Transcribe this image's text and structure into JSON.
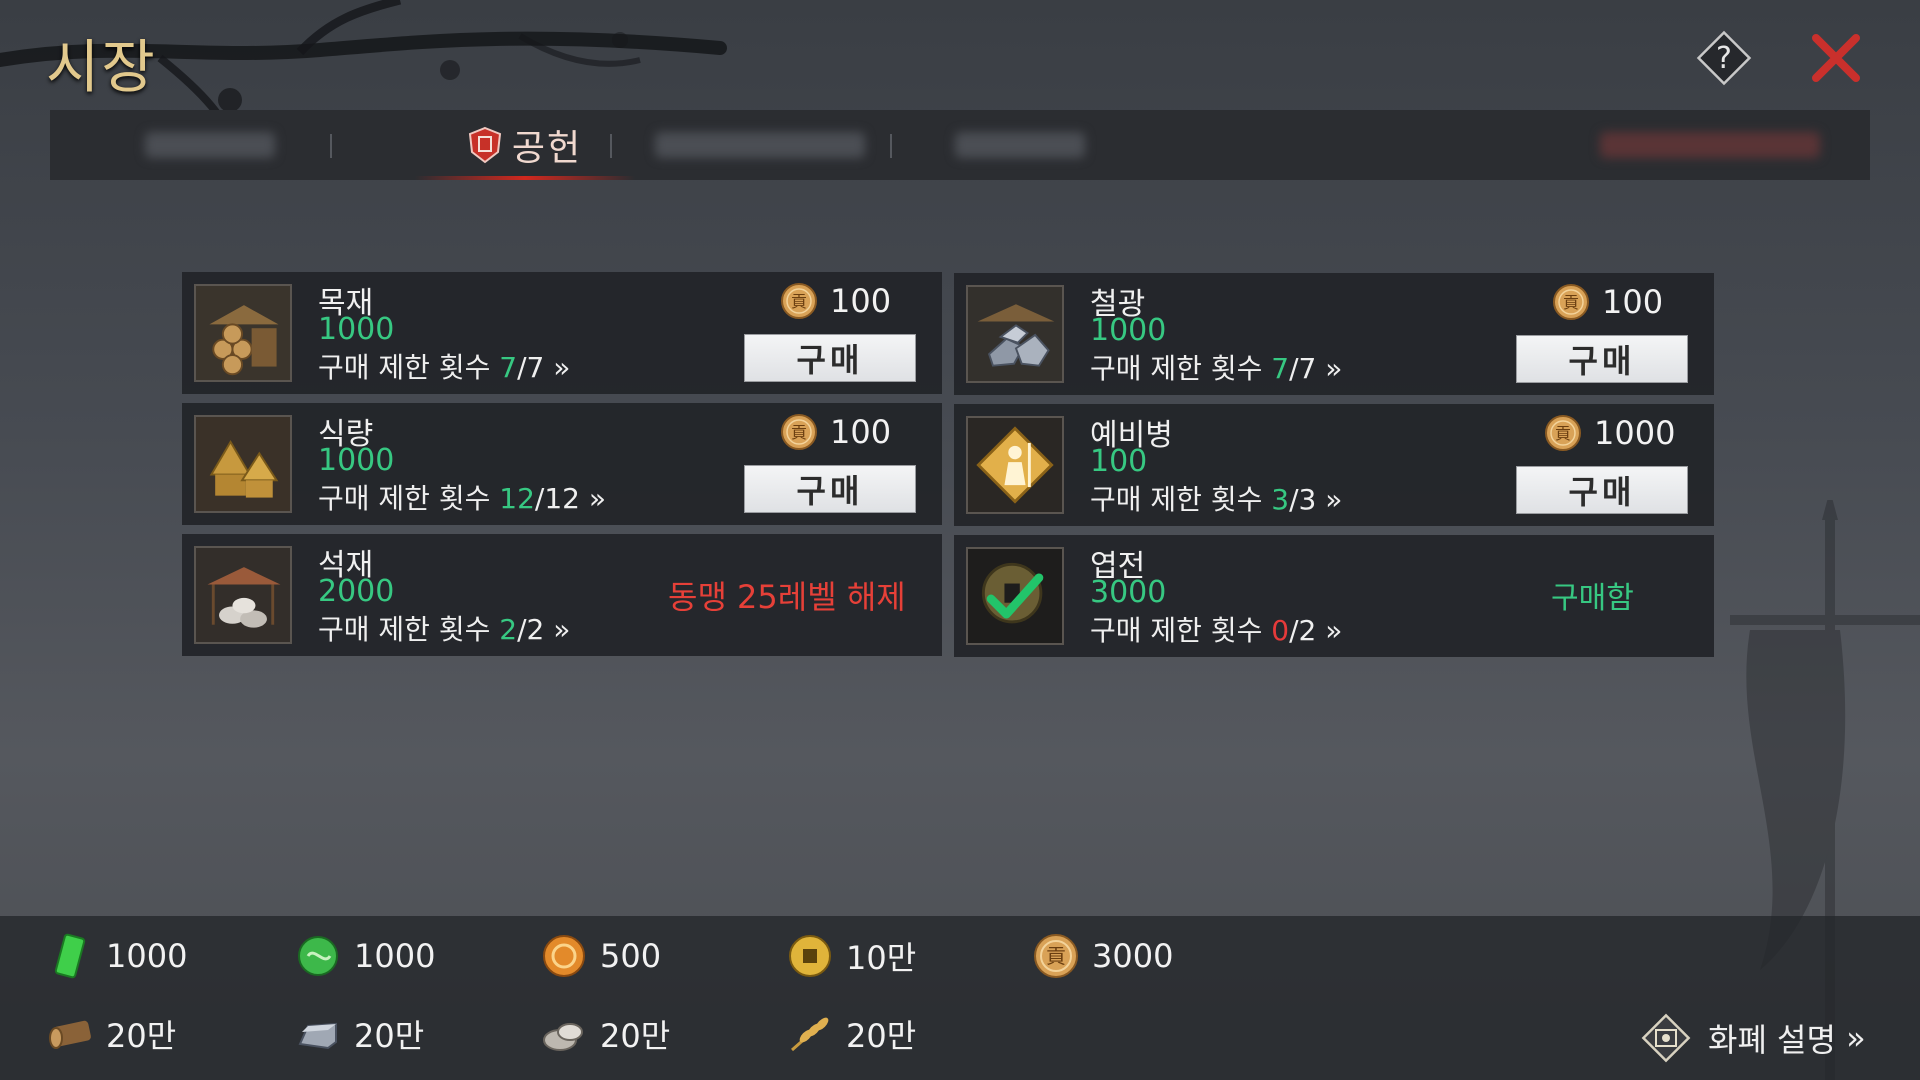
{
  "header": {
    "title": "시장"
  },
  "tabs": {
    "active_label": "공헌"
  },
  "items": [
    {
      "name": "목재",
      "amount": "1000",
      "limit_label": "구매 제한 횟수",
      "limit_used": "7",
      "limit_total": "/7",
      "more": "»",
      "price": "100",
      "buy_label": "구매"
    },
    {
      "name": "철광",
      "amount": "1000",
      "limit_label": "구매 제한 횟수",
      "limit_used": "7",
      "limit_total": "/7",
      "more": "»",
      "price": "100",
      "buy_label": "구매"
    },
    {
      "name": "식량",
      "amount": "1000",
      "limit_label": "구매 제한 횟수",
      "limit_used": "12",
      "limit_total": "/12",
      "more": "»",
      "price": "100",
      "buy_label": "구매"
    },
    {
      "name": "예비병",
      "amount": "100",
      "limit_label": "구매 제한 횟수",
      "limit_used": "3",
      "limit_total": "/3",
      "more": "»",
      "price": "1000",
      "buy_label": "구매"
    },
    {
      "name": "석재",
      "amount": "2000",
      "limit_label": "구매 제한  횟수",
      "limit_used": "2",
      "limit_total": "/2",
      "more": "»",
      "status": "동맹  25레벨  해제"
    },
    {
      "name": "엽전",
      "amount": "3000",
      "limit_label": "구매 제한 횟수",
      "limit_used": "0",
      "limit_total": "/2",
      "more": "»",
      "status": "구매함"
    }
  ],
  "resources": {
    "row1": [
      "1000",
      "1000",
      "500",
      "10만",
      "3000"
    ],
    "row2": [
      "20만",
      "20만",
      "20만",
      "20만"
    ]
  },
  "footer": {
    "explain_label": "화폐 설명",
    "explain_more": "»"
  },
  "colors": {
    "green": "#37c882",
    "red": "#e63a3a",
    "gold": "#e2c98d"
  }
}
